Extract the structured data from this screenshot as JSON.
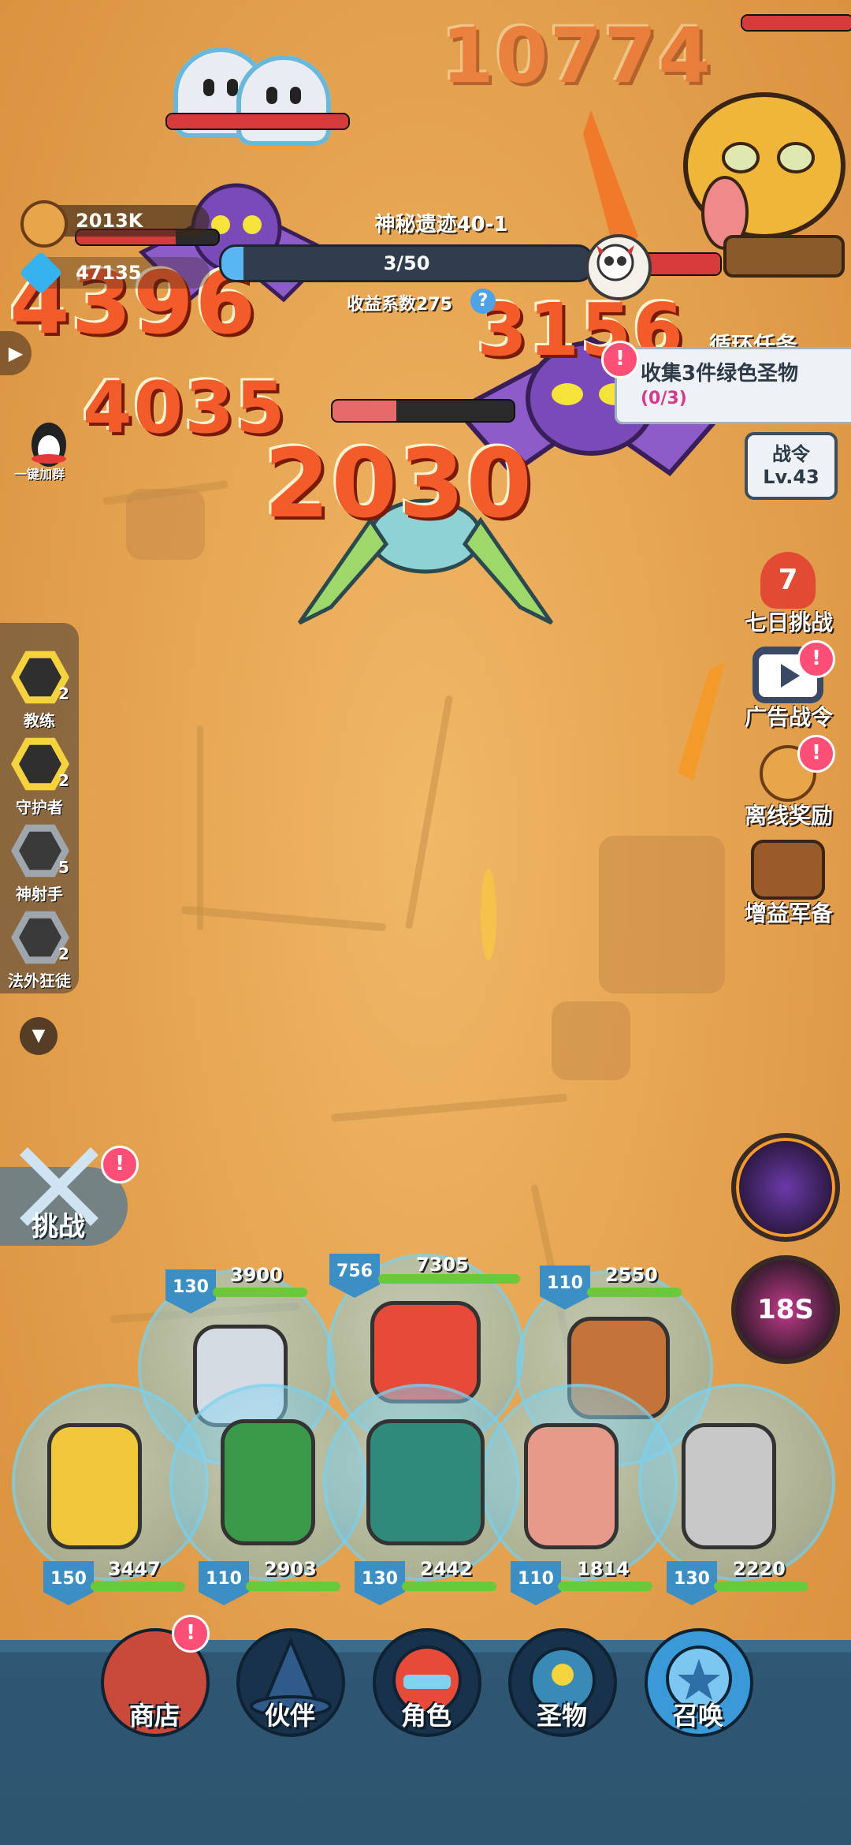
{
  "resources": {
    "coins": "2013K",
    "gems": "47135",
    "coin_icon": "paw-coin-icon",
    "gem_icon": "diamond-icon"
  },
  "stage": {
    "title": "神秘遗迹40-1",
    "wave_progress": "3/50",
    "wave_fraction": 0.06,
    "income_label": "收益系数275",
    "help_symbol": "?"
  },
  "damage_numbers": {
    "top_score": "10774",
    "d1": "4396",
    "d2": "4035",
    "d3": "3156",
    "d4": "2030"
  },
  "quest": {
    "title": "循环任务",
    "task": "收集3件绿色圣物",
    "progress": "(0/3)",
    "alert": "!"
  },
  "battle_pass": {
    "label": "战令",
    "level": "Lv.43"
  },
  "qq_group": {
    "label": "一键加群"
  },
  "right_menu": [
    {
      "label": "七日挑战",
      "icon": "medal-7-icon",
      "count": "7",
      "badge": ""
    },
    {
      "label": "广告战令",
      "icon": "video-play-icon",
      "badge": "!"
    },
    {
      "label": "离线奖励",
      "icon": "paw-coin-icon",
      "badge": "!"
    },
    {
      "label": "增益军备",
      "icon": "treasure-chest-icon",
      "badge": ""
    }
  ],
  "left_menu": [
    {
      "label": "教练",
      "count": "2",
      "icon": "dumbbell-icon"
    },
    {
      "label": "守护者",
      "count": "2",
      "icon": "shield-icon"
    },
    {
      "label": "神射手",
      "count": "5",
      "icon": "crosshair-icon"
    },
    {
      "label": "法外狂徒",
      "count": "2",
      "icon": "bomb-icon"
    }
  ],
  "challenge": {
    "label": "挑战",
    "alert": "!"
  },
  "skills": {
    "cooldown": "18S"
  },
  "heroes_back": [
    {
      "level": "130",
      "hp": "3900",
      "name": "knight"
    },
    {
      "level": "756",
      "hp": "7305",
      "name": "red-hair-leader"
    },
    {
      "level": "110",
      "hp": "2550",
      "name": "curly-brawler"
    }
  ],
  "heroes_front": [
    {
      "level": "150",
      "hp": "3447",
      "name": "blonde-gunner"
    },
    {
      "level": "110",
      "hp": "2903",
      "name": "elf-archer"
    },
    {
      "level": "130",
      "hp": "2442",
      "name": "tank-gunner"
    },
    {
      "level": "110",
      "hp": "1814",
      "name": "pink-rifle"
    },
    {
      "level": "130",
      "hp": "2220",
      "name": "cap-gunner"
    }
  ],
  "nav": [
    {
      "label": "商店",
      "icon": "shop-icon",
      "alert": "!"
    },
    {
      "label": "伙伴",
      "icon": "wizard-hat-icon"
    },
    {
      "label": "角色",
      "icon": "hero-face-icon"
    },
    {
      "label": "圣物",
      "icon": "relic-icon"
    },
    {
      "label": "召唤",
      "icon": "summon-orb-icon"
    }
  ]
}
